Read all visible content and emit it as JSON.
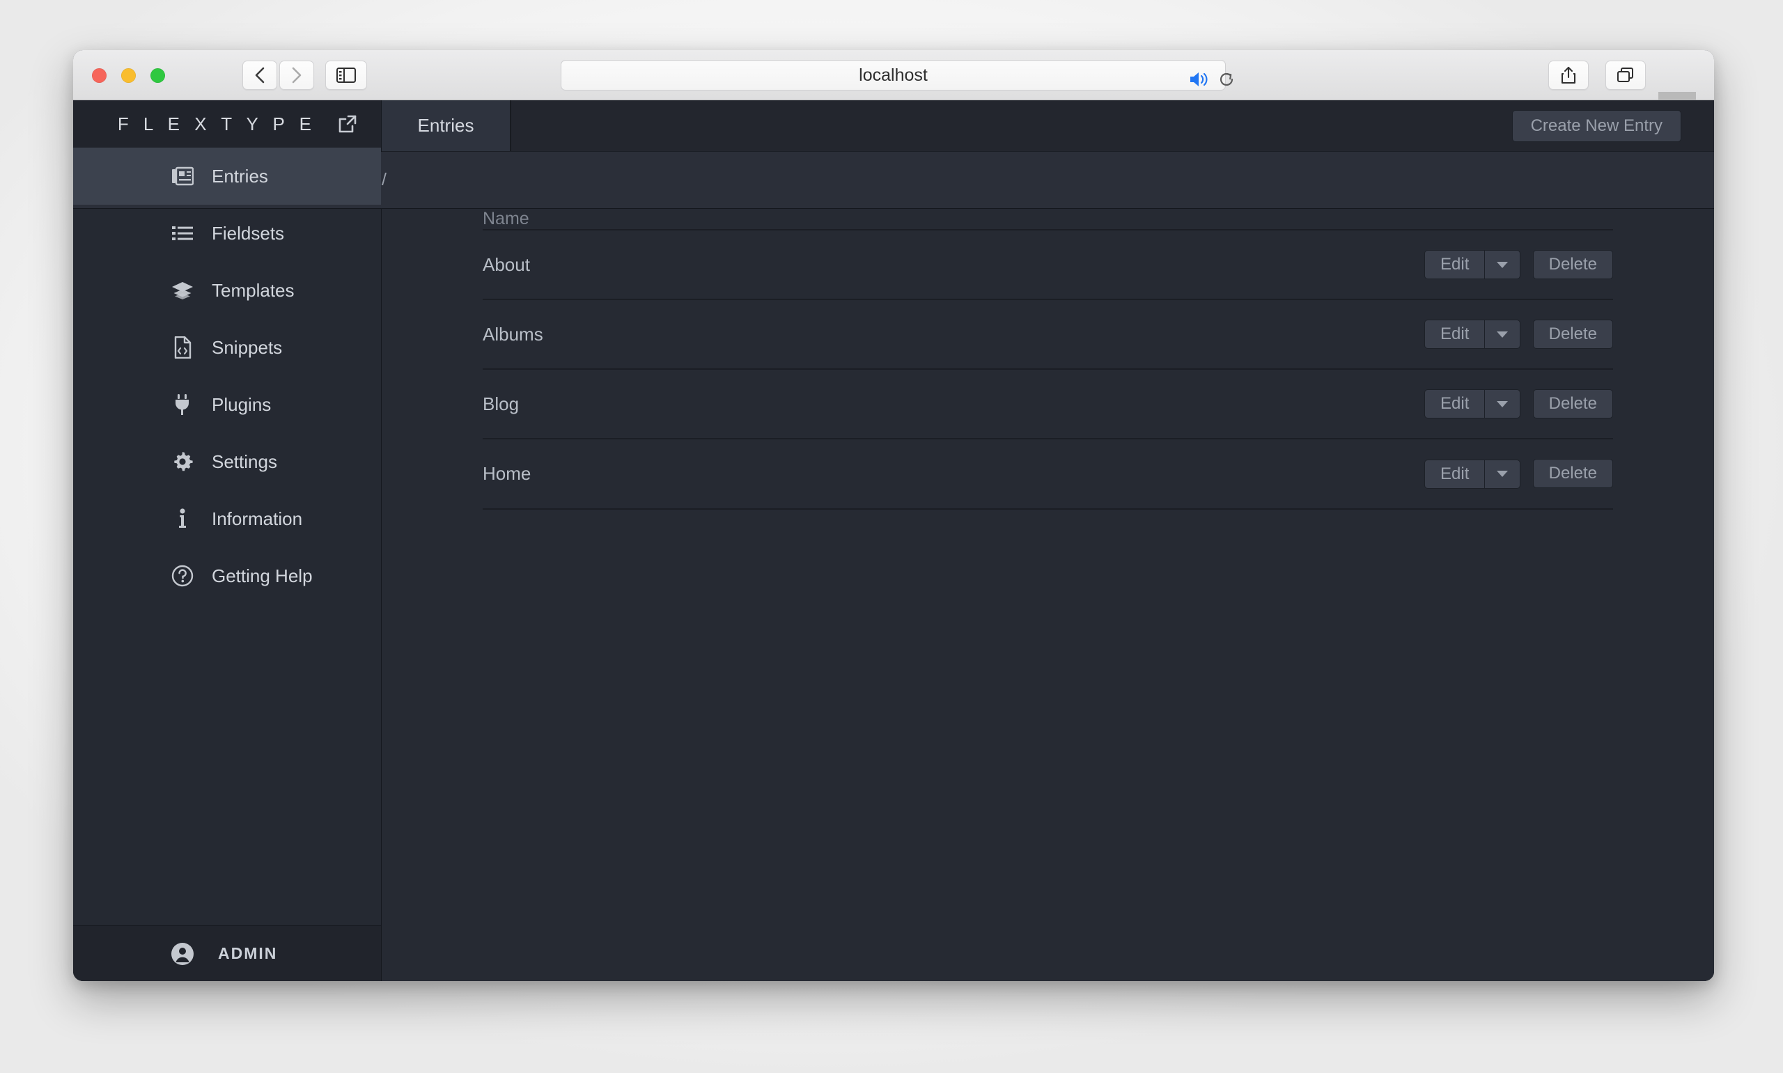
{
  "browser": {
    "url_text": "localhost",
    "back_icon": "chevron-left-icon",
    "forward_icon": "chevron-right-icon",
    "sidebar_icon": "sidebar-toggle-icon",
    "audio_icon": "speaker-playing-icon",
    "reload_icon": "reload-icon",
    "share_icon": "share-icon",
    "tabs_icon": "tab-overview-icon",
    "new_tab_label": "+"
  },
  "sidebar": {
    "brand": "F L E X T Y P E",
    "external_link_icon": "external-link-icon",
    "items": [
      {
        "label": "Entries",
        "icon": "newspaper-icon",
        "active": true
      },
      {
        "label": "Fieldsets",
        "icon": "list-icon",
        "active": false
      },
      {
        "label": "Templates",
        "icon": "layers-icon",
        "active": false
      },
      {
        "label": "Snippets",
        "icon": "file-code-icon",
        "active": false
      },
      {
        "label": "Plugins",
        "icon": "plug-icon",
        "active": false
      },
      {
        "label": "Settings",
        "icon": "gear-icon",
        "active": false
      },
      {
        "label": "Information",
        "icon": "info-icon",
        "active": false
      },
      {
        "label": "Getting Help",
        "icon": "question-circle-icon",
        "active": false
      }
    ],
    "footer": {
      "user": "ADMIN",
      "icon": "user-circle-icon"
    }
  },
  "main": {
    "tab_label": "Entries",
    "create_button": "Create New Entry",
    "breadcrumb": "/",
    "table": {
      "columns": [
        "Name"
      ],
      "rows": [
        {
          "name": "About",
          "edit": "Edit",
          "delete": "Delete"
        },
        {
          "name": "Albums",
          "edit": "Edit",
          "delete": "Delete"
        },
        {
          "name": "Blog",
          "edit": "Edit",
          "delete": "Delete"
        },
        {
          "name": "Home",
          "edit": "Edit",
          "delete": "Delete"
        }
      ]
    }
  },
  "colors": {
    "sidebar_bg": "#252932",
    "sidebar_dark": "#21242c",
    "active_item": "#3c424e",
    "content_bg": "#262a33",
    "button_bg": "#3a3f4b",
    "text": "#d2d6dd",
    "muted_text": "#9aa0ab",
    "audio_blue": "#2176f3"
  }
}
